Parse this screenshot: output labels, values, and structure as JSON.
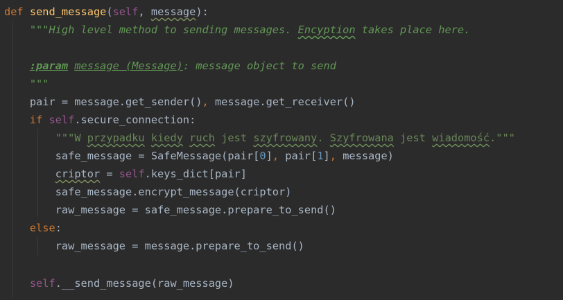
{
  "code": {
    "language": "python",
    "lines": {
      "l1": {
        "kw": "def",
        "fn": "send_message",
        "p1": "(",
        "self": "self",
        "p2": ", ",
        "typo": "message",
        "p3": "):"
      },
      "l2": {
        "a": "\"\"\"High level method to sending messages. ",
        "typo": "Encyption",
        "b": " takes place here."
      },
      "l4": {
        "tag": ":param",
        "sp": " ",
        "param": "message (Message)",
        "rest": ": message object to send"
      },
      "l5": {
        "text": "\"\"\""
      },
      "l6": {
        "a": "pair = message.get_sender()",
        "comma": ",",
        "b": " message.get_receiver()"
      },
      "l7": {
        "kw": "if",
        "sp": " ",
        "self": "self",
        "rest": ".secure_connection:"
      },
      "l8": {
        "q": "\"\"\"W ",
        "w1": "przypadku",
        "s1": " ",
        "w2": "kiedy",
        "s2": " ",
        "w3": "ruch",
        "s3": " jest ",
        "w4": "szyfrowany",
        "s4": ". ",
        "w5": "Szyfrowana",
        "s5": " jest ",
        "w6": "wiadomość",
        "end": ".\"\"\""
      },
      "l9": {
        "a": "safe_message = SafeMessage(pair[",
        "n1": "0",
        "b": "]",
        "c1": ",",
        "c": " pair[",
        "n2": "1",
        "d": "]",
        "c2": ",",
        "e": " message)"
      },
      "l10": {
        "typo": "criptor",
        "a": " = ",
        "self": "self",
        "b": ".keys_dict[pair]"
      },
      "l11": {
        "text": "safe_message.encrypt_message(criptor)"
      },
      "l12": {
        "text": "raw_message = safe_message.prepare_to_send()"
      },
      "l13": {
        "kw": "else",
        "rest": ":"
      },
      "l14": {
        "text": "raw_message = message.prepare_to_send()"
      },
      "l16": {
        "self": "self",
        "rest": ".__send_message(raw_message)"
      }
    }
  },
  "colors": {
    "background": "#2b2b2b",
    "default_text": "#a9b7c6",
    "keyword": "#cc7832",
    "function_name": "#ffc66d",
    "self": "#94558d",
    "number": "#6897bb",
    "docstring": "#629755",
    "string": "#6a8759"
  }
}
